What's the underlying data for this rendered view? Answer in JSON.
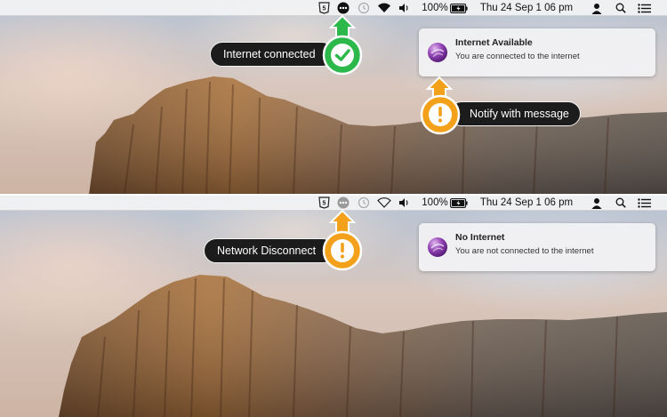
{
  "colors": {
    "success_green": "#2db84b",
    "warning_orange": "#f3a11a",
    "callout_dark": "#1c1c1c",
    "menubar_bg": "#f6f6f6",
    "notification_bg": "#f1f1f3"
  },
  "menubar_top": {
    "battery_percent": "100%",
    "datetime": "Thu 24 Sep  1 06 pm",
    "icons": [
      "html5-icon",
      "network-status-connected-icon",
      "time-machine-icon",
      "wifi-icon",
      "volume-icon",
      "battery-icon",
      "user-icon",
      "spotlight-search-icon",
      "notification-center-icon"
    ]
  },
  "menubar_bottom": {
    "battery_percent": "100%",
    "datetime": "Thu 24 Sep  1 06 pm",
    "icons": [
      "html5-icon",
      "network-status-disconnected-icon",
      "time-machine-icon",
      "wifi-icon",
      "volume-icon",
      "battery-icon",
      "user-icon",
      "spotlight-search-icon",
      "notification-center-icon"
    ]
  },
  "top": {
    "status_callout": {
      "label": "Internet connected",
      "icon": "checkmark-icon"
    },
    "notification": {
      "title": "Internet Available",
      "message": "You are connected to the internet",
      "icon": "network-app-icon"
    },
    "notify_callout": {
      "label": "Notify with message",
      "icon": "exclamation-icon"
    }
  },
  "bottom": {
    "status_callout": {
      "label": "Network Disconnect",
      "icon": "exclamation-icon"
    },
    "notification": {
      "title": "No Internet",
      "message": "You are not connected to the internet",
      "icon": "network-app-icon"
    }
  }
}
